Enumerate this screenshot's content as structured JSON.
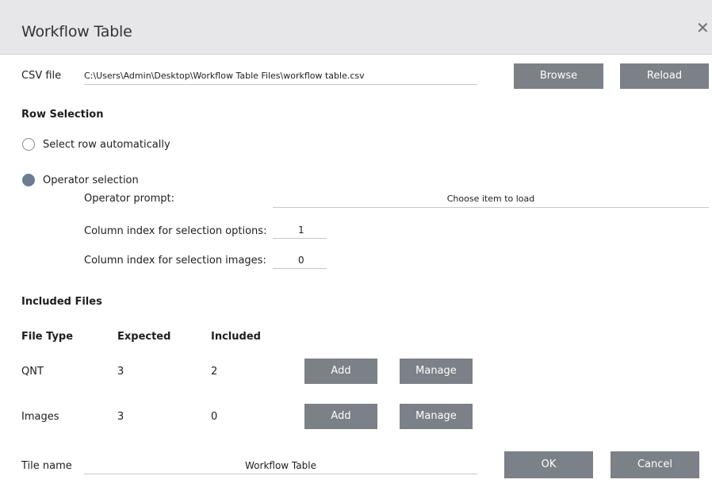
{
  "dialog": {
    "title": "Workflow Table",
    "close_glyph": "✕"
  },
  "csv": {
    "label": "CSV file",
    "path": "C:\\Users\\Admin\\Desktop\\Workflow Table Files\\workflow table.csv",
    "browse_label": "Browse",
    "reload_label": "Reload"
  },
  "row_selection": {
    "heading": "Row Selection",
    "option_auto": "Select row automatically",
    "option_operator": "Operator selection",
    "selected": "operator",
    "prompt_label": "Operator prompt:",
    "prompt_value": "Choose item to load",
    "options_index_label": "Column index for selection options:",
    "options_index_value": "1",
    "images_index_label": "Column index for selection images:",
    "images_index_value": "0"
  },
  "included_files": {
    "heading": "Included Files",
    "columns": [
      "File Type",
      "Expected",
      "Included"
    ],
    "rows": [
      {
        "type": "QNT",
        "expected": "3",
        "included": "2",
        "add_label": "Add",
        "manage_label": "Manage"
      },
      {
        "type": "Images",
        "expected": "3",
        "included": "0",
        "add_label": "Add",
        "manage_label": "Manage"
      }
    ]
  },
  "tile": {
    "label": "Tile name",
    "value": "Workflow Table"
  },
  "footer": {
    "ok_label": "OK",
    "cancel_label": "Cancel"
  },
  "colors": {
    "button_bg": "#7c8087",
    "titlebar_bg": "#e7e7ea",
    "radio_selected": "#6d7b93"
  }
}
